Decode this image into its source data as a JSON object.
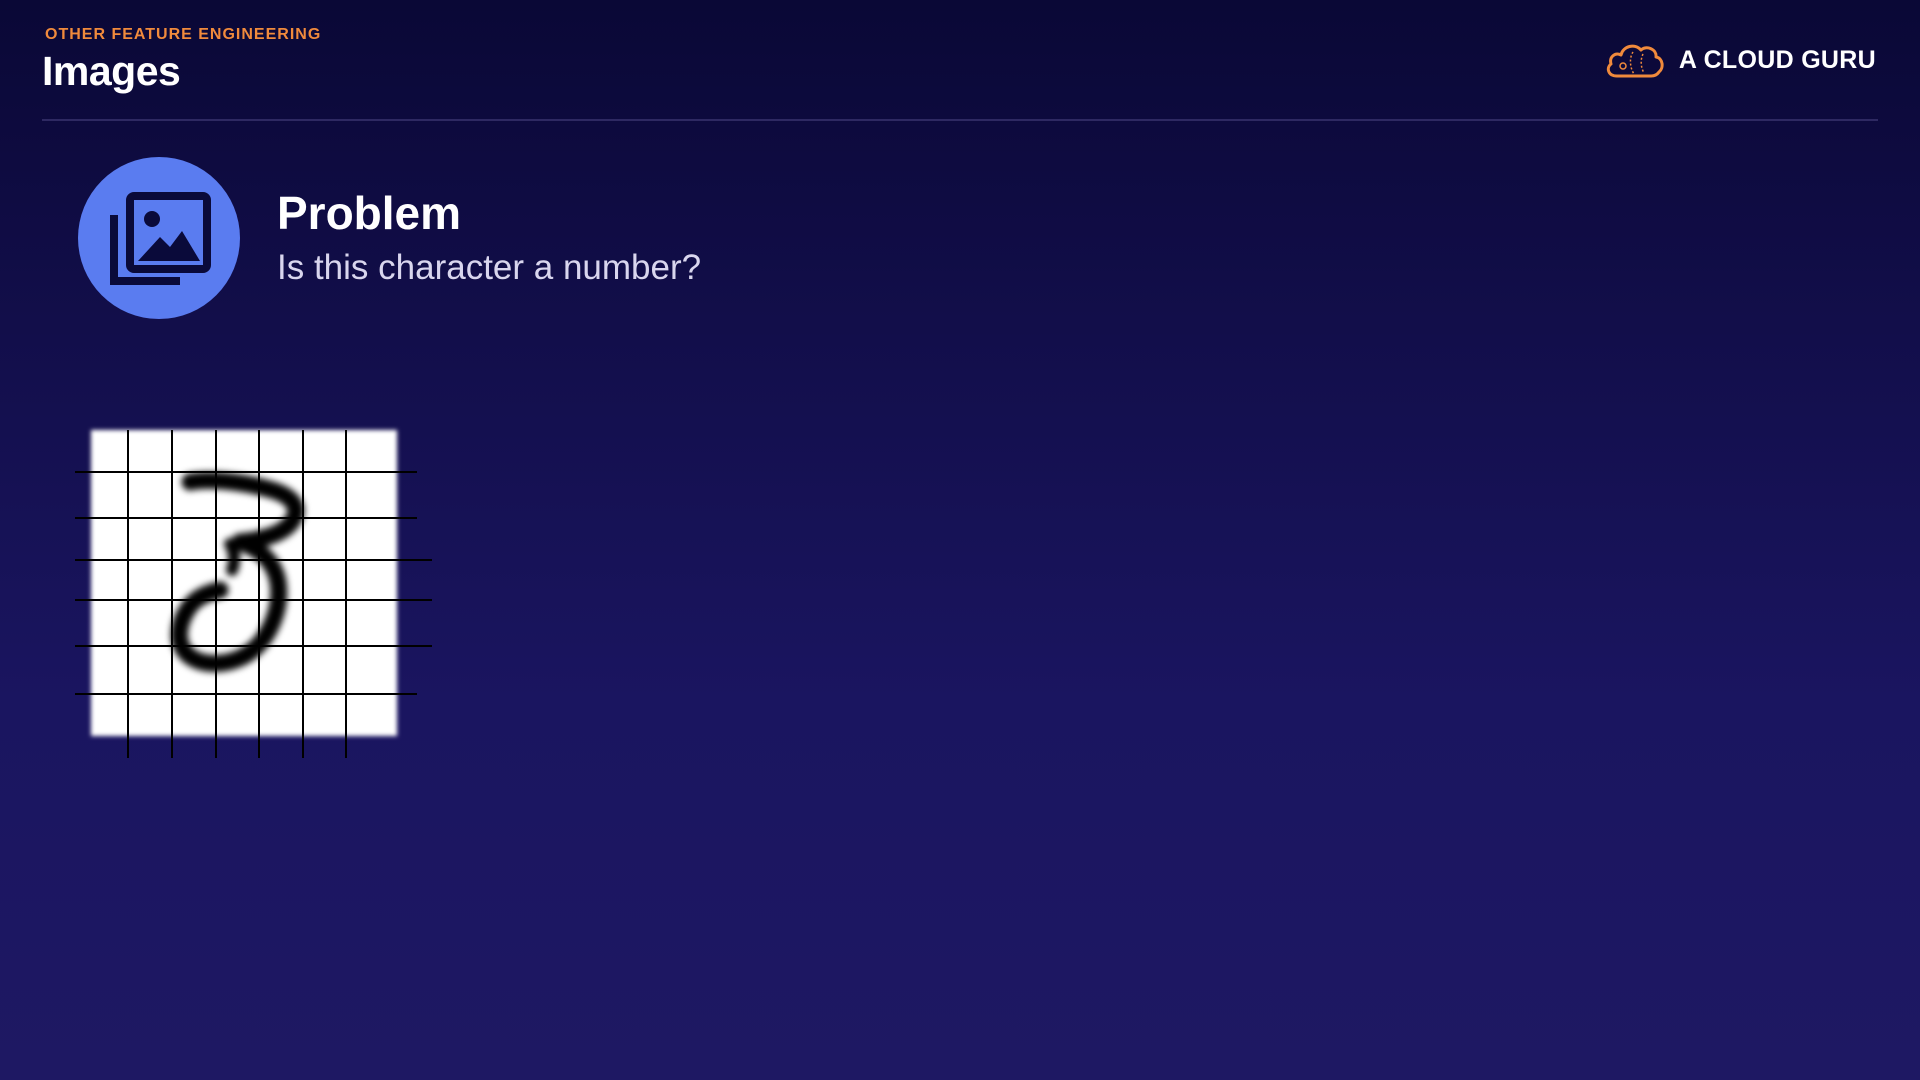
{
  "header": {
    "eyebrow": "OTHER FEATURE ENGINEERING",
    "title": "Images"
  },
  "brand": {
    "name": "A CLOUD GURU",
    "logo_icon": "cloud-icon",
    "logo_color": "#f08a3c"
  },
  "problem": {
    "icon": "image-gallery-icon",
    "icon_bg_color": "#5a7cf0",
    "heading": "Problem",
    "question": "Is this character a number?"
  },
  "figure": {
    "description_icon": "handwritten-digit-grid",
    "grid_color": "#000000",
    "background_color": "#ffffff"
  },
  "colors": {
    "accent": "#f08a3c",
    "background_top": "#0a0836",
    "background_bottom": "#1e1863"
  }
}
